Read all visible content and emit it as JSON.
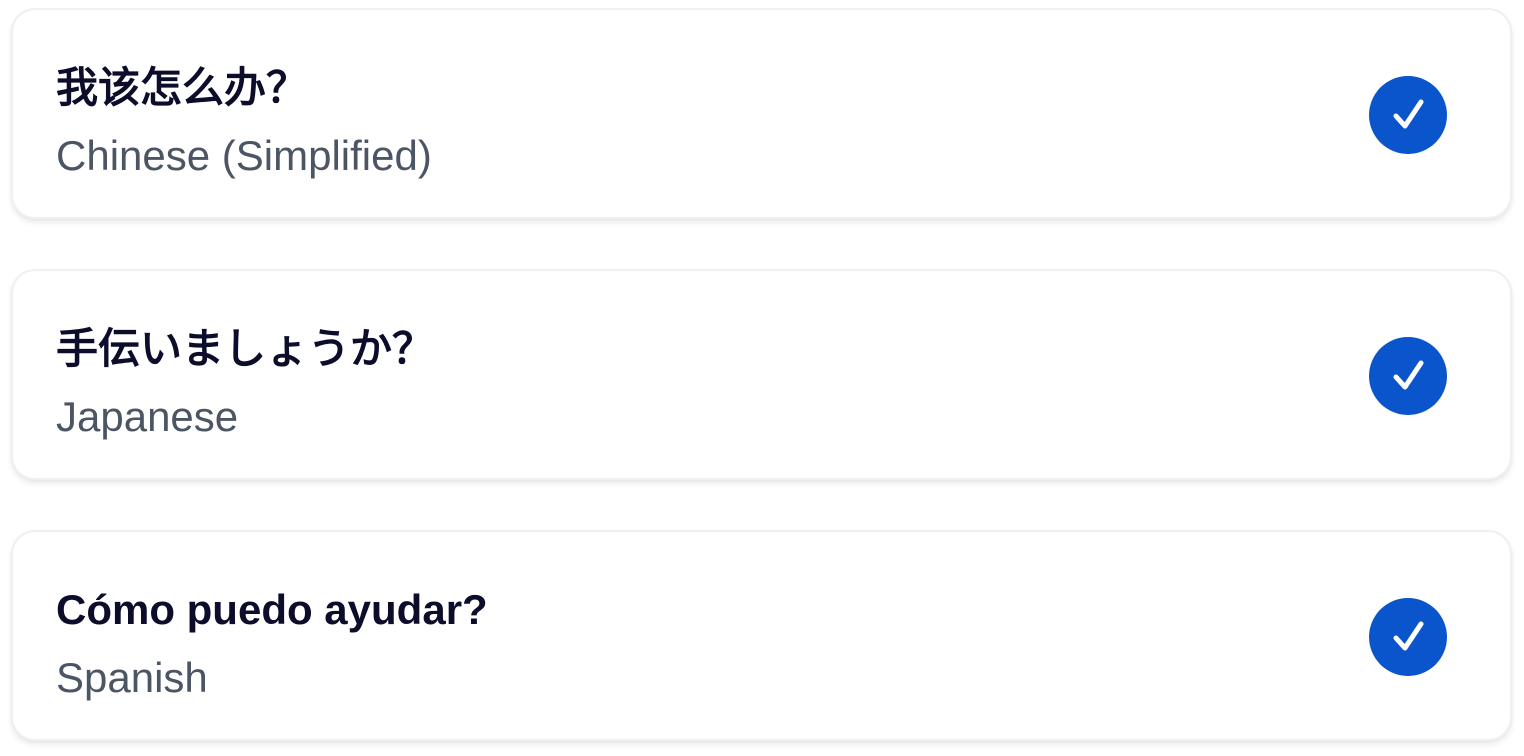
{
  "colors": {
    "accent": "#0a55cc",
    "phrase_text": "#0b0d2a",
    "language_text": "#4b5563",
    "card_border": "#eef0f3"
  },
  "items": [
    {
      "phrase": "我该怎么办？",
      "language": "Chinese (Simplified)",
      "selected": true,
      "icon": "checkmark-circle-icon"
    },
    {
      "phrase": "手伝いましょうか？",
      "language": "Japanese",
      "selected": true,
      "icon": "checkmark-circle-icon"
    },
    {
      "phrase": "Cómo puedo ayudar?",
      "language": "Spanish",
      "selected": true,
      "icon": "checkmark-circle-icon"
    }
  ]
}
